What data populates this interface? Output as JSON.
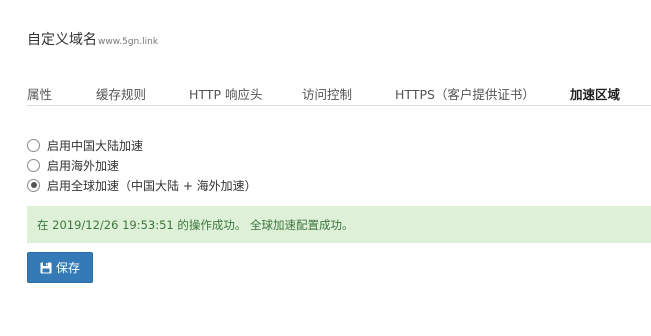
{
  "header": {
    "title": "自定义域名",
    "domain": "www.5gn.link"
  },
  "tabs": [
    {
      "label": "属性",
      "active": false
    },
    {
      "label": "缓存规则",
      "active": false
    },
    {
      "label": "HTTP 响应头",
      "active": false
    },
    {
      "label": "访问控制",
      "active": false
    },
    {
      "label": "HTTPS（客户提供证书）",
      "active": false
    },
    {
      "label": "加速区域",
      "active": true
    }
  ],
  "acceleration_options": [
    {
      "label": "启用中国大陆加速",
      "checked": false
    },
    {
      "label": "启用海外加速",
      "checked": false
    },
    {
      "label": "启用全球加速（中国大陆 + 海外加速）",
      "checked": true
    }
  ],
  "alert": {
    "message": "在 2019/12/26 19:53:51 的操作成功。 全球加速配置成功。"
  },
  "actions": {
    "save_label": "保存",
    "save_icon": "save-icon"
  },
  "colors": {
    "accent": "#337ab7",
    "success_bg": "#dff0d8",
    "success_text": "#3c763d"
  }
}
